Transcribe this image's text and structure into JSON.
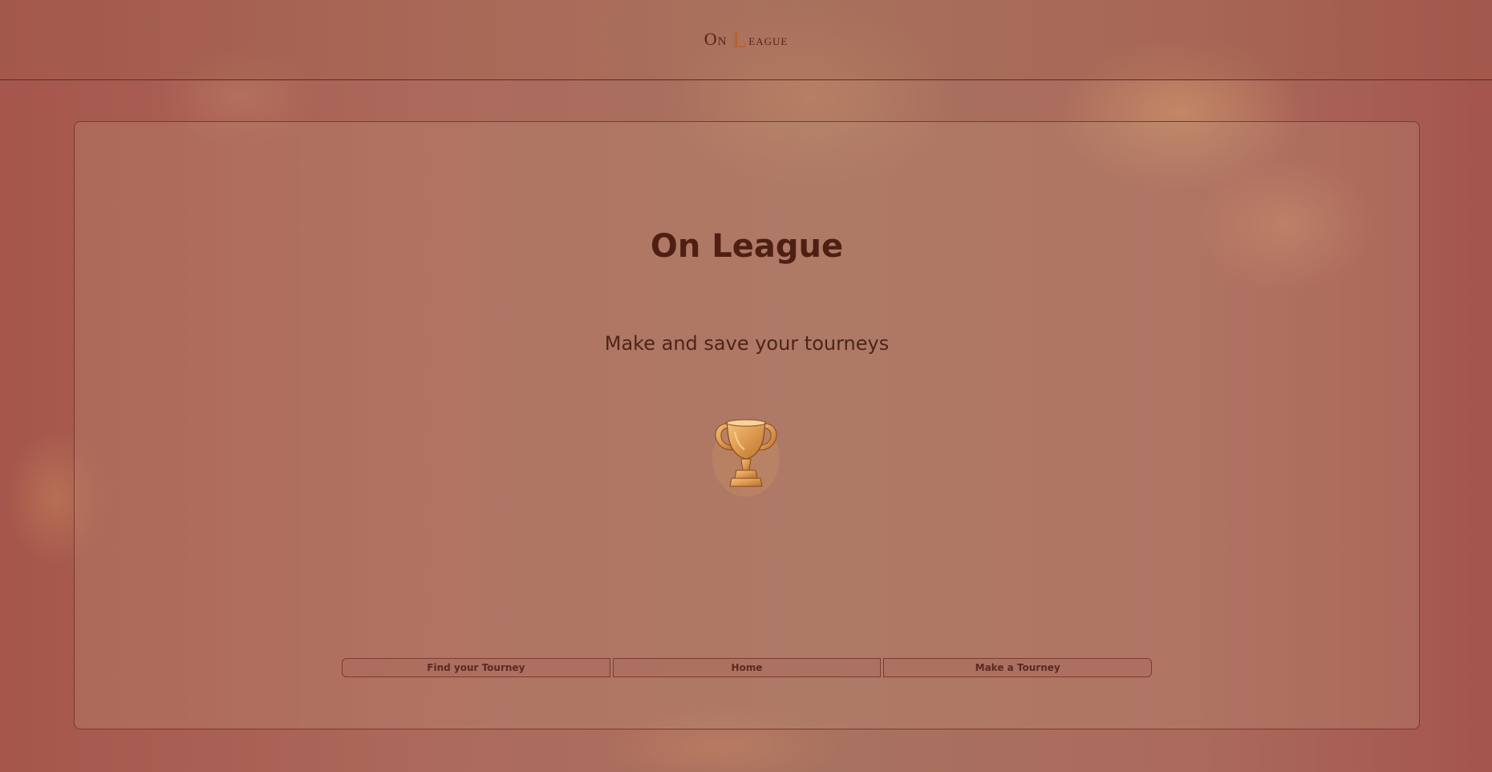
{
  "header": {
    "logo": {
      "part1": "On",
      "part2": "League",
      "part2_initial": "L",
      "part2_rest": "eague"
    }
  },
  "main": {
    "title": "On League",
    "subtitle": "Make and save your tourneys",
    "image_icon": "trophy-icon"
  },
  "nav": {
    "buttons": [
      {
        "label": "Find your Tourney"
      },
      {
        "label": "Home"
      },
      {
        "label": "Make a Tourney"
      }
    ]
  },
  "colors": {
    "text_dark": "#4e1f12",
    "accent_gold": "#d9964a",
    "border": "#7a3a30"
  }
}
